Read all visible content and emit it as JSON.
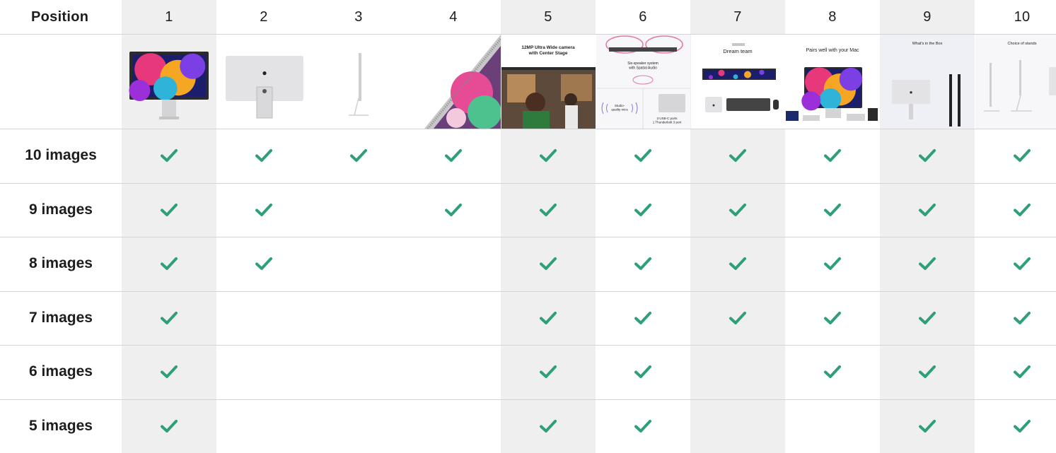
{
  "table": {
    "corner_label": "Position",
    "columns": [
      {
        "label": "1",
        "thumb": "studio-display-front"
      },
      {
        "label": "2",
        "thumb": "studio-display-back"
      },
      {
        "label": "3",
        "thumb": "studio-display-side"
      },
      {
        "label": "4",
        "thumb": "studio-display-edge-closeup"
      },
      {
        "label": "5",
        "thumb": "camera-feature",
        "caption": "12MP Ultra Wide camera\nwith Center Stage"
      },
      {
        "label": "6",
        "thumb": "audio-ports-feature",
        "caption": "Six-speaker system\nwith Spatial Audio",
        "caption2": "Studio-\nquality mics",
        "caption3": "3 USB-C ports\n1 Thunderbolt 3 port"
      },
      {
        "label": "7",
        "thumb": "dream-team",
        "caption": "Dream team"
      },
      {
        "label": "8",
        "thumb": "pairs-with-mac",
        "caption": "Pairs well with your Mac"
      },
      {
        "label": "9",
        "thumb": "whats-in-the-box",
        "caption": "What's in the Box"
      },
      {
        "label": "10",
        "thumb": "choice-of-stands",
        "caption": "Choice of stands"
      }
    ],
    "rows": [
      {
        "label": "10 images",
        "checks": [
          true,
          true,
          true,
          true,
          true,
          true,
          true,
          true,
          true,
          true
        ]
      },
      {
        "label": "9 images",
        "checks": [
          true,
          true,
          false,
          true,
          true,
          true,
          true,
          true,
          true,
          true
        ]
      },
      {
        "label": "8 images",
        "checks": [
          true,
          true,
          false,
          false,
          true,
          true,
          true,
          true,
          true,
          true
        ]
      },
      {
        "label": "7 images",
        "checks": [
          true,
          false,
          false,
          false,
          true,
          true,
          true,
          true,
          true,
          true
        ]
      },
      {
        "label": "6 images",
        "checks": [
          true,
          false,
          false,
          false,
          true,
          true,
          false,
          true,
          true,
          true
        ]
      },
      {
        "label": "5 images",
        "checks": [
          true,
          false,
          false,
          false,
          true,
          true,
          false,
          false,
          true,
          true
        ]
      }
    ],
    "shaded_columns": [
      1,
      5,
      7,
      9
    ],
    "check_color": "#2f9f7b",
    "shade_color": "#efefef",
    "rule_color": "#d2d2d7",
    "check_icon": "checkmark-icon"
  }
}
